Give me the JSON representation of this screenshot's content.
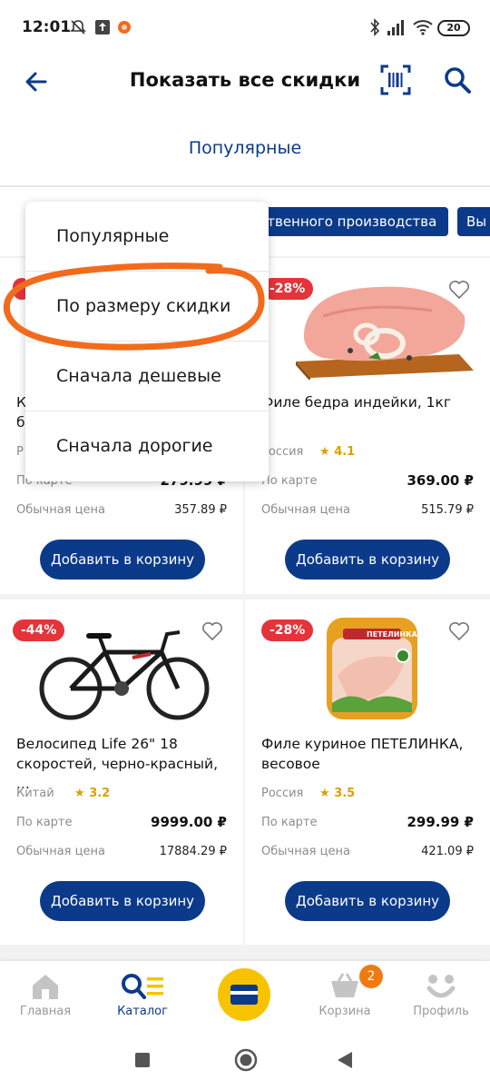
{
  "status_bar": {
    "time": "12:01",
    "battery": "20"
  },
  "header": {
    "title": "Показать все скидки"
  },
  "sort": {
    "current": "Популярные"
  },
  "chips": [
    {
      "label": "ственного производства"
    },
    {
      "label": "Вы"
    }
  ],
  "dropdown": {
    "options": [
      "Популярные",
      "По размеру скидки",
      "Сначала дешевые",
      "Сначала дорогие"
    ]
  },
  "products": [
    {
      "name": "Филе бедра индейки, 1кг",
      "discount": "-28%",
      "origin": "Россия",
      "rating": "4.1",
      "card_label": "По карте",
      "card_price": "369.00 ₽",
      "regular_label": "Обычная цена",
      "regular_price": "515.79 ₽",
      "button": "Добавить в корзину"
    },
    {
      "name": "Велосипед Life 26\" 18 скоростей, черно-красный, ...",
      "discount": "-44%",
      "origin": "Китай",
      "rating": "3.2",
      "card_label": "По карте",
      "card_price": "9999.00 ₽",
      "regular_label": "Обычная цена",
      "regular_price": "17884.29 ₽",
      "button": "Добавить в корзину"
    },
    {
      "name": "Филе куриное ПЕТЕЛИНКА, весовое",
      "discount": "-28%",
      "origin": "Россия",
      "rating": "3.5",
      "card_label": "По карте",
      "card_price": "299.99 ₽",
      "regular_label": "Обычная цена",
      "regular_price": "421.09 ₽",
      "button": "Добавить в корзину"
    }
  ],
  "hidden_card": {
    "card_label": "По карте",
    "card_price": "279.99 ₽",
    "regular_label": "Обычная цена",
    "regular_price": "357.89 ₽",
    "button": "Добавить в корзину",
    "name_fragment_1": "К",
    "name_fragment_2": "б",
    "origin_fragment": "Р"
  },
  "chicken_brand": "ПЕТЕЛИНКА",
  "bottom_nav": {
    "items": [
      {
        "label": "Главная"
      },
      {
        "label": "Каталог"
      },
      {
        "label": "Корзина"
      },
      {
        "label": "Профиль"
      }
    ],
    "cart_count": "2"
  },
  "colors": {
    "brand_blue": "#0b3a8a",
    "badge_red": "#e5333a",
    "accent_yellow": "#f7c300",
    "annotation_orange": "#f26b1d"
  }
}
